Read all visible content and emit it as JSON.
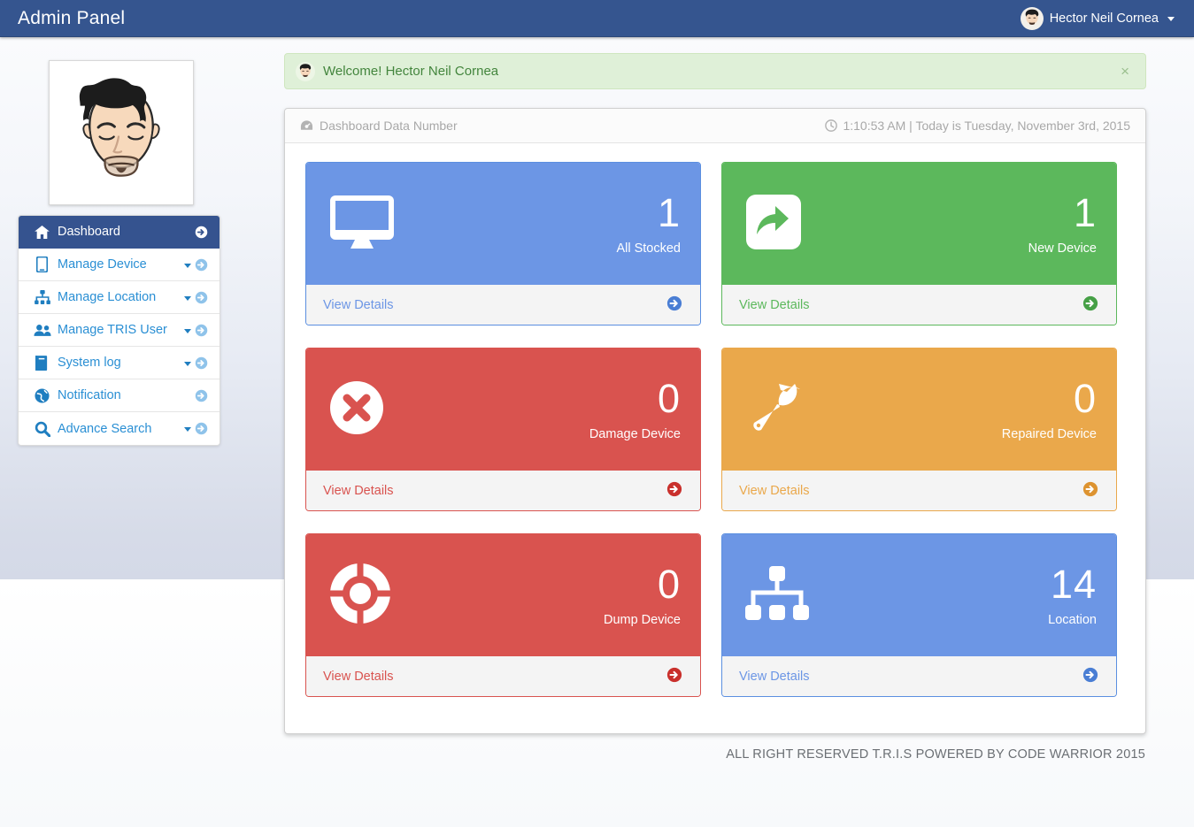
{
  "topbar": {
    "brand": "Admin Panel",
    "user_name": "Hector Neil Cornea",
    "avatar_icon": "user-avatar-icon",
    "caret_icon": "caret-down-icon"
  },
  "alert": {
    "avatar_icon": "user-avatar-icon",
    "message": "Welcome! Hector Neil Cornea",
    "close_label": "×"
  },
  "sidebar": {
    "profile_avatar_icon": "user-avatar-large-icon",
    "items": [
      {
        "label": "Dashboard",
        "icon": "home-icon",
        "active": true,
        "has_caret": false
      },
      {
        "label": "Manage Device",
        "icon": "tablet-icon",
        "active": false,
        "has_caret": true
      },
      {
        "label": "Manage Location",
        "icon": "sitemap-icon",
        "active": false,
        "has_caret": true
      },
      {
        "label": "Manage TRIS User",
        "icon": "users-icon",
        "active": false,
        "has_caret": true
      },
      {
        "label": "System log",
        "icon": "book-icon",
        "active": false,
        "has_caret": true
      },
      {
        "label": "Notification",
        "icon": "globe-icon",
        "active": false,
        "has_caret": false
      },
      {
        "label": "Advance Search",
        "icon": "search-icon",
        "active": false,
        "has_caret": true
      }
    ]
  },
  "panel": {
    "title": "Dashboard Data Number",
    "title_icon": "dashboard-gauge-icon",
    "clock_icon": "clock-icon",
    "time_text": "1:10:53 AM  | Today is Tuesday, November 3rd, 2015"
  },
  "cards": [
    {
      "value": "1",
      "label": "All Stocked",
      "icon": "desktop-icon",
      "color": "blue",
      "hex": "#6c96e5",
      "footer": "View Details",
      "arrow_icon": "circle-arrow-right-icon"
    },
    {
      "value": "1",
      "label": "New Device",
      "icon": "share-icon",
      "color": "green",
      "hex": "#5cb85c",
      "footer": "View Details",
      "arrow_icon": "circle-arrow-right-icon"
    },
    {
      "value": "0",
      "label": "Damage Device",
      "icon": "times-circle-icon",
      "color": "red",
      "hex": "#d9534f",
      "footer": "View Details",
      "arrow_icon": "circle-arrow-right-icon"
    },
    {
      "value": "0",
      "label": "Repaired Device",
      "icon": "wrench-icon",
      "color": "orange",
      "hex": "#eaa84b",
      "footer": "View Details",
      "arrow_icon": "circle-arrow-right-icon"
    },
    {
      "value": "0",
      "label": "Dump Device",
      "icon": "life-ring-icon",
      "color": "red",
      "hex": "#d9534f",
      "footer": "View Details",
      "arrow_icon": "circle-arrow-right-icon"
    },
    {
      "value": "14",
      "label": "Location",
      "icon": "sitemap-icon",
      "color": "blue",
      "hex": "#6c96e5",
      "footer": "View Details",
      "arrow_icon": "circle-arrow-right-icon"
    }
  ],
  "footer": {
    "text": "ALL RIGHT RESERVED T.R.I.S POWERED BY CODE WARRIOR 2015"
  },
  "theme": {
    "navbar": "#35558f",
    "sidebar_active": "#35538f",
    "link": "#2a8fd4",
    "alert_bg": "#dff0d8",
    "alert_text": "#43853d"
  }
}
